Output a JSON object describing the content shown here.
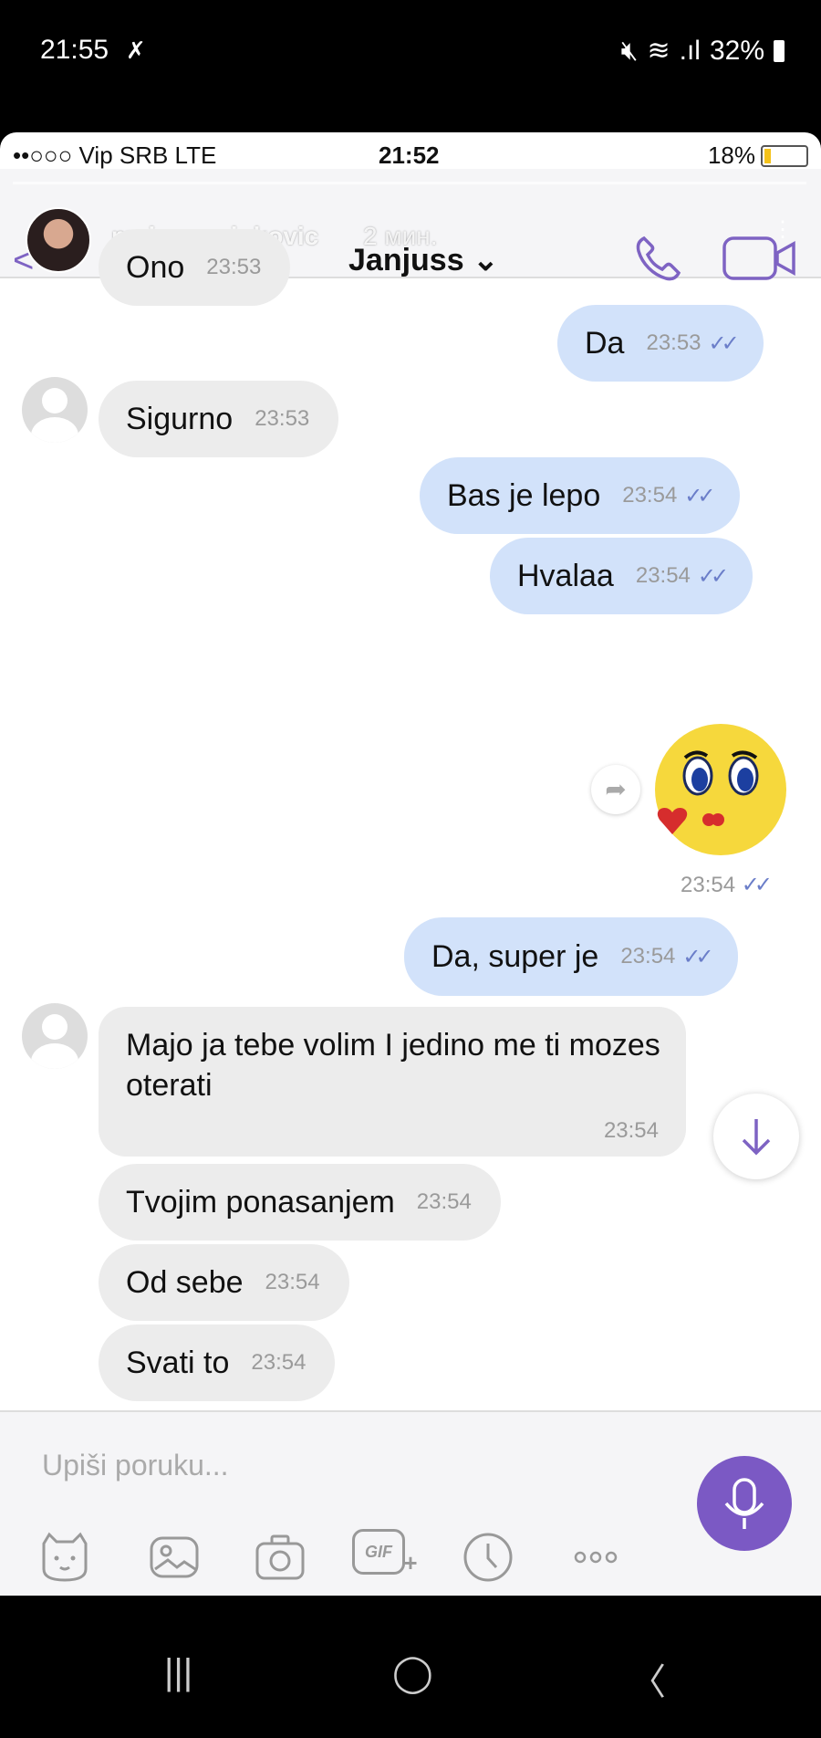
{
  "android_status": {
    "time": "21:55",
    "battery": "32%"
  },
  "ios_status": {
    "carrier": "••○○○ Vip SRB  LTE",
    "time": "21:52",
    "battery": "18%"
  },
  "story": {
    "username": "majaamarinkovic",
    "age": "2 мин."
  },
  "header": {
    "contact_name": "Janjuss ⌄"
  },
  "messages": [
    {
      "text": "Ono",
      "time": "23:53",
      "dir": "in"
    },
    {
      "text": "Da",
      "time": "23:53",
      "dir": "out"
    },
    {
      "text": "Sigurno",
      "time": "23:53",
      "dir": "in"
    },
    {
      "text": "Bas je lepo",
      "time": "23:54",
      "dir": "out"
    },
    {
      "text": "Hvalaa",
      "time": "23:54",
      "dir": "out"
    },
    {
      "text": "Da, super je",
      "time": "23:54",
      "dir": "out"
    },
    {
      "text": "Majo ja tebe volim I jedino me ti mozes oterati",
      "time": "23:54",
      "dir": "in"
    },
    {
      "text": "Tvojim ponasanjem",
      "time": "23:54",
      "dir": "in"
    },
    {
      "text": "Od sebe",
      "time": "23:54",
      "dir": "in"
    },
    {
      "text": "Svati to",
      "time": "23:54",
      "dir": "in"
    }
  ],
  "sticker": {
    "time": "23:54",
    "ticks": "✓✓"
  },
  "ticks": "✓✓",
  "composer": {
    "placeholder": "Upiši poruku...",
    "gif_label": "GIF"
  },
  "nav": {
    "recents": "|||",
    "home": "◯",
    "back": "〈"
  }
}
